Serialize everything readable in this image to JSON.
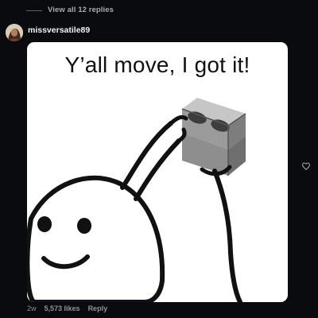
{
  "thread": {
    "view_replies": "View all 12 replies"
  },
  "comment": {
    "username": "missversatile89",
    "meme_caption": "Y’all move, I got it!",
    "timestamp": "2w",
    "likes": "5,573 likes",
    "reply_label": "Reply"
  },
  "icons": {
    "like": "heart-outline-icon"
  },
  "colors": {
    "background": "#0a0b0f",
    "username": "#f2f2f2",
    "muted_text": "#8e9199"
  }
}
